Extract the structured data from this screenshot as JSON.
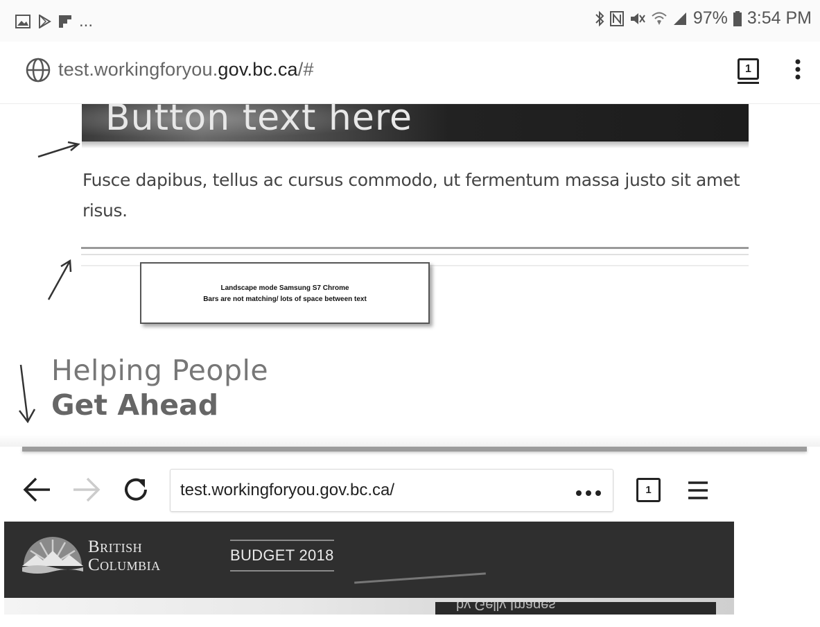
{
  "status_bar": {
    "left_icons": [
      "gallery-icon",
      "play-store-icon",
      "flipboard-icon"
    ],
    "more": "...",
    "right_icons": [
      "bluetooth-icon",
      "nfc-icon",
      "mute-icon",
      "wifi-icon",
      "signal-icon"
    ],
    "battery": "97%",
    "time": "3:54 PM"
  },
  "chrome_bar": {
    "url_prefix": "test.workingforyou.",
    "url_domain": "gov.bc.ca",
    "url_suffix": "/#",
    "tab_count": "1"
  },
  "page": {
    "banner_text": "Button text here",
    "body_text": "Fusce dapibus, tellus ac cursus commodo, ut fermentum massa justo sit amet risus.",
    "annotation": {
      "line1": "Landscape mode Samsung S7 Chrome",
      "line2": "Bars are not matching/  lots of space between text"
    },
    "heading_line1": "Helping People",
    "heading_line2": "Get Ahead"
  },
  "firefox_bar": {
    "url": "test.workingforyou.gov.bc.ca/",
    "tab_count": "1"
  },
  "bc_header": {
    "name_line1": "British",
    "name_line2": "Columbia",
    "budget_label": "BUDGET 2018",
    "mirrored_text": "by Gelly Images"
  },
  "colors": {
    "header_bg": "#2f2f2f",
    "divider": "#9c9c9c"
  }
}
